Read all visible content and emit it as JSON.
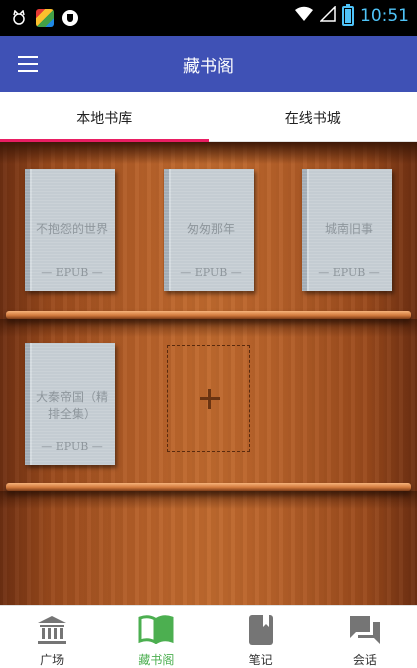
{
  "status_bar": {
    "time": "10:51"
  },
  "app_bar": {
    "title": "藏书阁"
  },
  "tabs": [
    {
      "label": "本地书库",
      "active": true
    },
    {
      "label": "在线书城",
      "active": false
    }
  ],
  "books": [
    {
      "title": "不抱怨的世界",
      "tag": "— EPUB —"
    },
    {
      "title": "匆匆那年",
      "tag": "— EPUB —"
    },
    {
      "title": "城南旧事",
      "tag": "— EPUB —"
    },
    {
      "title": "大秦帝国（精排全集）",
      "tag": "— EPUB —"
    }
  ],
  "bottom_nav": [
    {
      "label": "广场",
      "icon": "bank-icon",
      "active": false
    },
    {
      "label": "藏书阁",
      "icon": "open-book-icon",
      "active": true
    },
    {
      "label": "笔记",
      "icon": "notebook-icon",
      "active": false
    },
    {
      "label": "会话",
      "icon": "chat-icon",
      "active": false
    }
  ],
  "colors": {
    "app_bar": "#3f51b5",
    "tab_indicator": "#e91e63",
    "active_nav": "#4caf50",
    "time": "#4fc3f7"
  }
}
